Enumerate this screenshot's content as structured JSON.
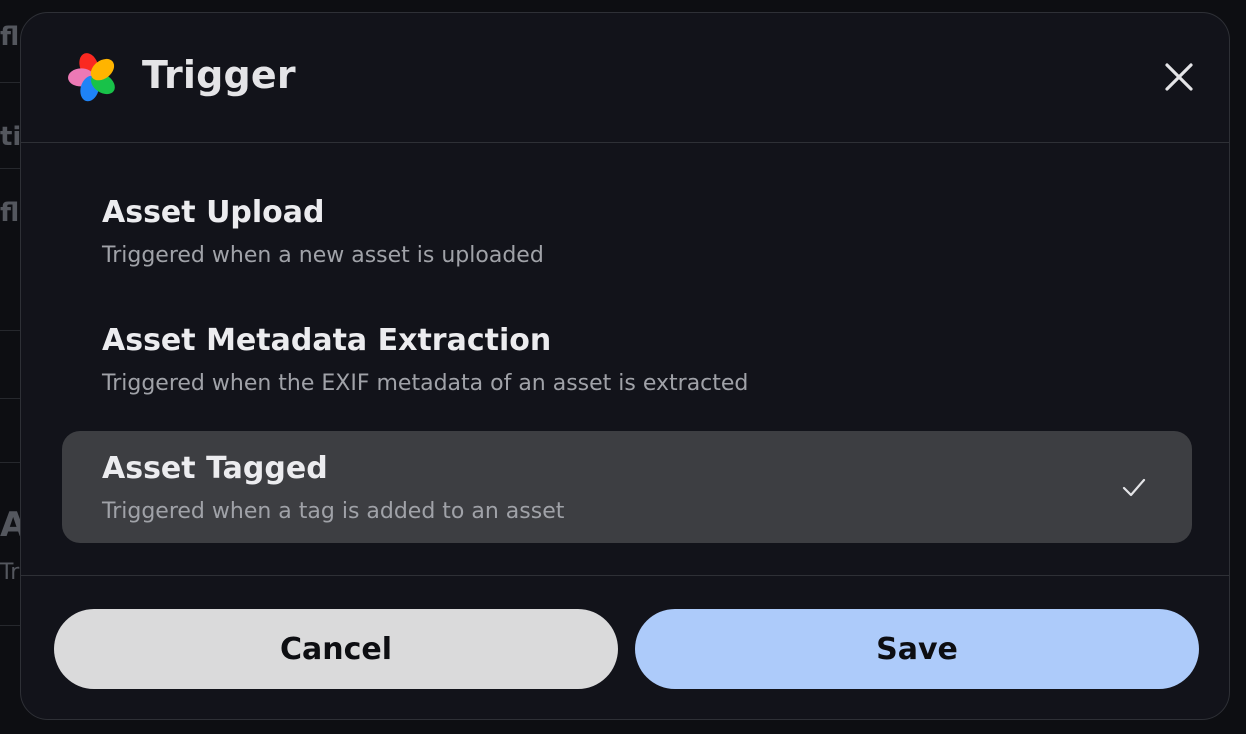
{
  "background": {
    "fragments": [
      "fl",
      "ti",
      "fl",
      "A",
      "Tr"
    ]
  },
  "dialog": {
    "title": "Trigger",
    "logo_icon": "immich-pinwheel-logo",
    "close_icon": "close-icon"
  },
  "options": [
    {
      "title": "Asset Upload",
      "description": "Triggered when a new asset is uploaded",
      "selected": false
    },
    {
      "title": "Asset Metadata Extraction",
      "description": "Triggered when the EXIF metadata of an asset is extracted",
      "selected": false
    },
    {
      "title": "Asset Tagged",
      "description": "Triggered when a tag is added to an asset",
      "selected": true
    }
  ],
  "footer": {
    "cancel_label": "Cancel",
    "save_label": "Save"
  },
  "colors": {
    "primary": "#adcbfa",
    "selected_bg": "#3d3e42",
    "surface": "#12131a"
  }
}
